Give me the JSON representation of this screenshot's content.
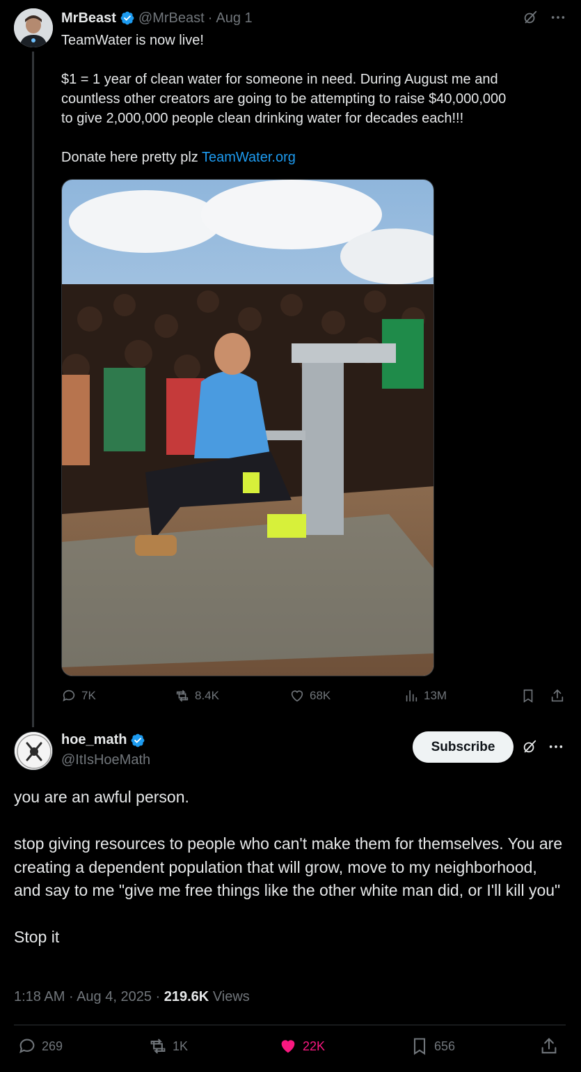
{
  "parent_tweet": {
    "author_name": "MrBeast",
    "handle": "@MrBeast",
    "date": "Aug 1",
    "separator": "·",
    "text_lines": [
      "TeamWater is now live!",
      "",
      "$1 = 1 year of clean water for someone in need. During August me and",
      "countless other creators are going to be attempting to raise $40,000,000",
      "to give 2,000,000 people clean drinking water for decades each!!!",
      ""
    ],
    "donate_prefix": "Donate here pretty plz ",
    "donate_link": "TeamWater.org",
    "stats": {
      "replies": "7K",
      "reposts": "8.4K",
      "likes": "68K",
      "views": "13M"
    }
  },
  "reply_tweet": {
    "author_name": "hoe_math",
    "handle": "@ItIsHoeMath",
    "subscribe_label": "Subscribe",
    "paragraphs": [
      "you are an awful person.",
      "stop giving resources to people who can't make them for themselves. You are creating a dependent population that will grow, move to my neighborhood, and say to me \"give me free things like the other white man did, or I'll kill you\"",
      "Stop it"
    ],
    "time": "1:18 AM",
    "date": "Aug 4, 2025",
    "separator": "·",
    "views_count": "219.6K",
    "views_label": "Views",
    "stats": {
      "replies": "269",
      "reposts": "1K",
      "likes": "22K",
      "bookmarks": "656"
    }
  },
  "colors": {
    "background": "#000000",
    "text": "#e7e9ea",
    "muted": "#71767b",
    "link": "#1d9bf0",
    "verified": "#1d9bf0",
    "like_active": "#f91880",
    "subscribe_bg": "#eff3f4"
  },
  "icons": [
    "verified-badge-icon",
    "grok-icon",
    "more-icon",
    "reply-icon",
    "repost-icon",
    "like-icon",
    "views-icon",
    "bookmark-icon",
    "share-icon"
  ]
}
